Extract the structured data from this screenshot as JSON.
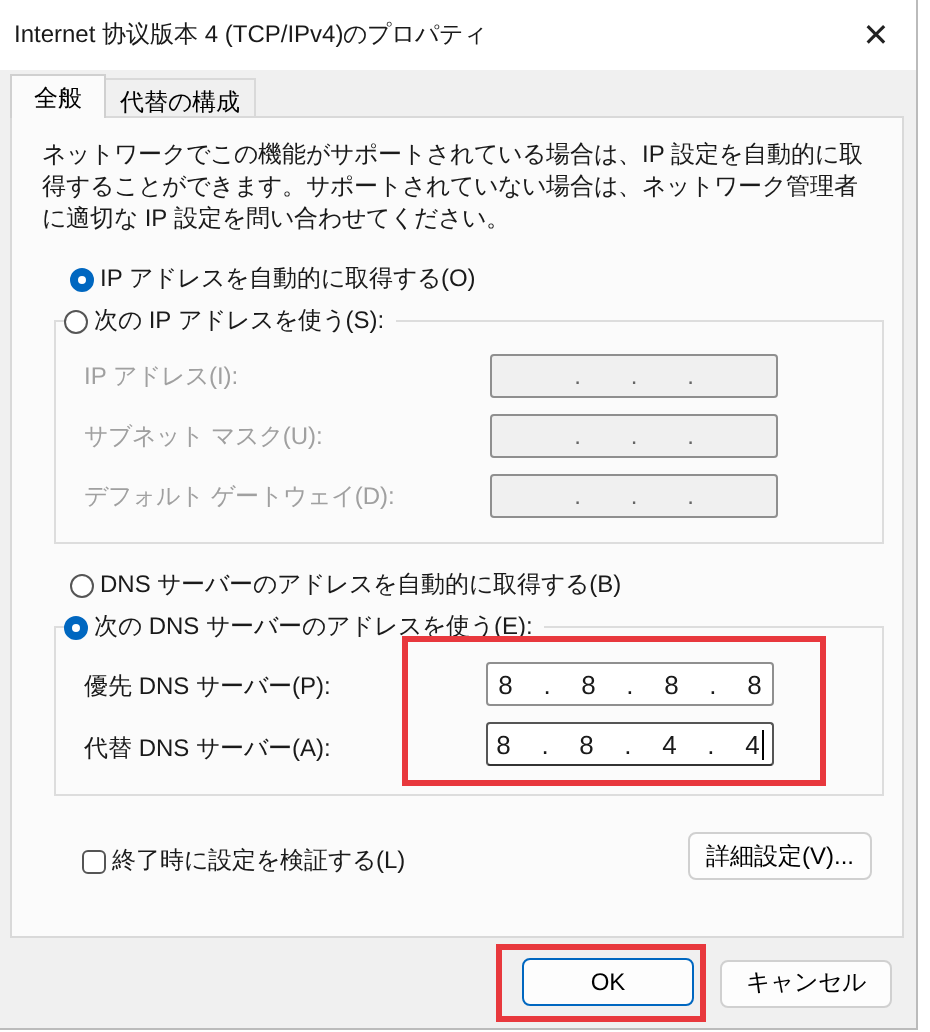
{
  "window": {
    "title": "Internet 协议版本 4 (TCP/IPv4)のプロパティ",
    "close": "✕"
  },
  "tabs": [
    {
      "label": "全般",
      "selected": true
    },
    {
      "label": "代替の構成",
      "selected": false
    }
  ],
  "description": "ネットワークでこの機能がサポートされている場合は、IP 設定を自動的に取得することができます。サポートされていない場合は、ネットワーク管理者に適切な IP 設定を問い合わせてください。",
  "ip_mode": [
    {
      "label": "IP アドレスを自動的に取得する(O)",
      "selected": true
    },
    {
      "label": "次の IP アドレスを使う(S):",
      "selected": false
    }
  ],
  "ip_fields": [
    {
      "label": "IP アドレス(I):",
      "value": ". . .",
      "disabled": true
    },
    {
      "label": "サブネット マスク(U):",
      "value": ". . .",
      "disabled": true
    },
    {
      "label": "デフォルト ゲートウェイ(D):",
      "value": ". . .",
      "disabled": true
    }
  ],
  "dns_mode": [
    {
      "label": "DNS サーバーのアドレスを自動的に取得する(B)",
      "selected": false
    },
    {
      "label": "次の DNS サーバーのアドレスを使う(E):",
      "selected": true
    }
  ],
  "dns_fields": {
    "highlighted": true,
    "items": [
      {
        "label": "優先 DNS サーバー(P):",
        "value": "8 . 8 . 8 . 8",
        "focused": false
      },
      {
        "label": "代替 DNS サーバー(A):",
        "value": "8 . 8 . 4 . 4",
        "focused": true
      }
    ]
  },
  "validate": {
    "label": "終了時に設定を検証する(L)",
    "checked": false
  },
  "advanced_button": "詳細設定(V)...",
  "buttons": [
    {
      "label": "OK",
      "default": true,
      "highlighted": true
    },
    {
      "label": "キャンセル",
      "default": false,
      "highlighted": false
    }
  ]
}
